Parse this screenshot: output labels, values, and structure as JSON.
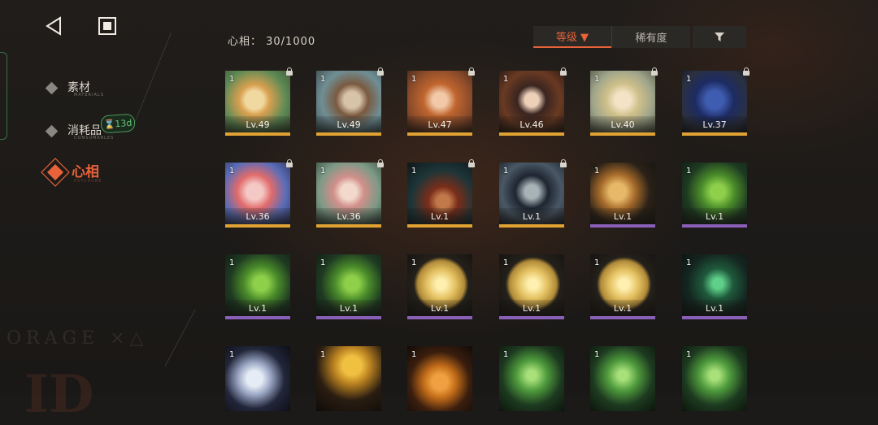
{
  "nav": {
    "back_icon": "back-triangle-icon",
    "home_icon": "square-stop-icon"
  },
  "sidebar": {
    "items": [
      {
        "label": "素材",
        "sub": "MATERIALS",
        "active": false
      },
      {
        "label": "消耗品",
        "sub": "CONSUMABLES",
        "active": false
      },
      {
        "label": "心相",
        "sub": "PSYCHUBE",
        "active": true
      }
    ],
    "badge": "⌛13d"
  },
  "header": {
    "count_label": "心相： 30/1000"
  },
  "sort": {
    "level_label": "等级 ▼",
    "rarity_label": "稀有度",
    "filter_icon": "filter-funnel-icon"
  },
  "background": {
    "watermark": "ORAGE ×△",
    "ghost_text": "ID"
  },
  "colors": {
    "accent": "#e8623a",
    "gold_rarity": "#e0a232",
    "purple_rarity": "#8a5fb8",
    "timer_green": "#68c277"
  },
  "cards": [
    {
      "qty": "1",
      "level": "Lv.49",
      "rarity": "gold",
      "locked": true,
      "art": "blonde-girl-portrait"
    },
    {
      "qty": "1",
      "level": "Lv.49",
      "rarity": "gold",
      "locked": true,
      "art": "hat-boy-portrait"
    },
    {
      "qty": "1",
      "level": "Lv.47",
      "rarity": "gold",
      "locked": true,
      "art": "redhead-girl-portrait"
    },
    {
      "qty": "1",
      "level": "Lv.46",
      "rarity": "gold",
      "locked": true,
      "art": "dark-hair-girl-portrait"
    },
    {
      "qty": "1",
      "level": "Lv.40",
      "rarity": "gold",
      "locked": true,
      "art": "blonde-lady-portrait"
    },
    {
      "qty": "1",
      "level": "Lv.37",
      "rarity": "gold",
      "locked": true,
      "art": "blue-flowers-still-life"
    },
    {
      "qty": "1",
      "level": "Lv.36",
      "rarity": "gold",
      "locked": true,
      "art": "pink-hair-girl-portrait"
    },
    {
      "qty": "1",
      "level": "Lv.36",
      "rarity": "gold",
      "locked": true,
      "art": "twin-girls-portrait"
    },
    {
      "qty": "1",
      "level": "Lv.1",
      "rarity": "gold",
      "locked": true,
      "art": "witch-hat-scene"
    },
    {
      "qty": "1",
      "level": "Lv.1",
      "rarity": "gold",
      "locked": true,
      "art": "top-hat-figure"
    },
    {
      "qty": "1",
      "level": "Lv.1",
      "rarity": "purple",
      "locked": false,
      "art": "golden-unicorn"
    },
    {
      "qty": "1",
      "level": "Lv.1",
      "rarity": "purple",
      "locked": false,
      "art": "green-creature"
    },
    {
      "qty": "1",
      "level": "Lv.1",
      "rarity": "purple",
      "locked": false,
      "art": "green-creature"
    },
    {
      "qty": "1",
      "level": "Lv.1",
      "rarity": "purple",
      "locked": false,
      "art": "green-creature"
    },
    {
      "qty": "1",
      "level": "Lv.1",
      "rarity": "purple",
      "locked": false,
      "art": "gold-coin"
    },
    {
      "qty": "1",
      "level": "Lv.1",
      "rarity": "purple",
      "locked": false,
      "art": "gold-coin"
    },
    {
      "qty": "1",
      "level": "Lv.1",
      "rarity": "purple",
      "locked": false,
      "art": "gold-coin"
    },
    {
      "qty": "1",
      "level": "Lv.1",
      "rarity": "purple",
      "locked": false,
      "art": "green-dark-creature"
    },
    {
      "qty": "1",
      "level": "",
      "rarity": "none",
      "locked": false,
      "art": "white-feather"
    },
    {
      "qty": "1",
      "level": "",
      "rarity": "none",
      "locked": false,
      "art": "yellow-mask-figure"
    },
    {
      "qty": "1",
      "level": "",
      "rarity": "none",
      "locked": false,
      "art": "orange-pumpkin"
    },
    {
      "qty": "1",
      "level": "",
      "rarity": "none",
      "locked": false,
      "art": "green-vine-tendrils"
    },
    {
      "qty": "1",
      "level": "",
      "rarity": "none",
      "locked": false,
      "art": "green-vine-tendrils"
    },
    {
      "qty": "1",
      "level": "",
      "rarity": "none",
      "locked": false,
      "art": "green-vine-tendrils"
    }
  ]
}
